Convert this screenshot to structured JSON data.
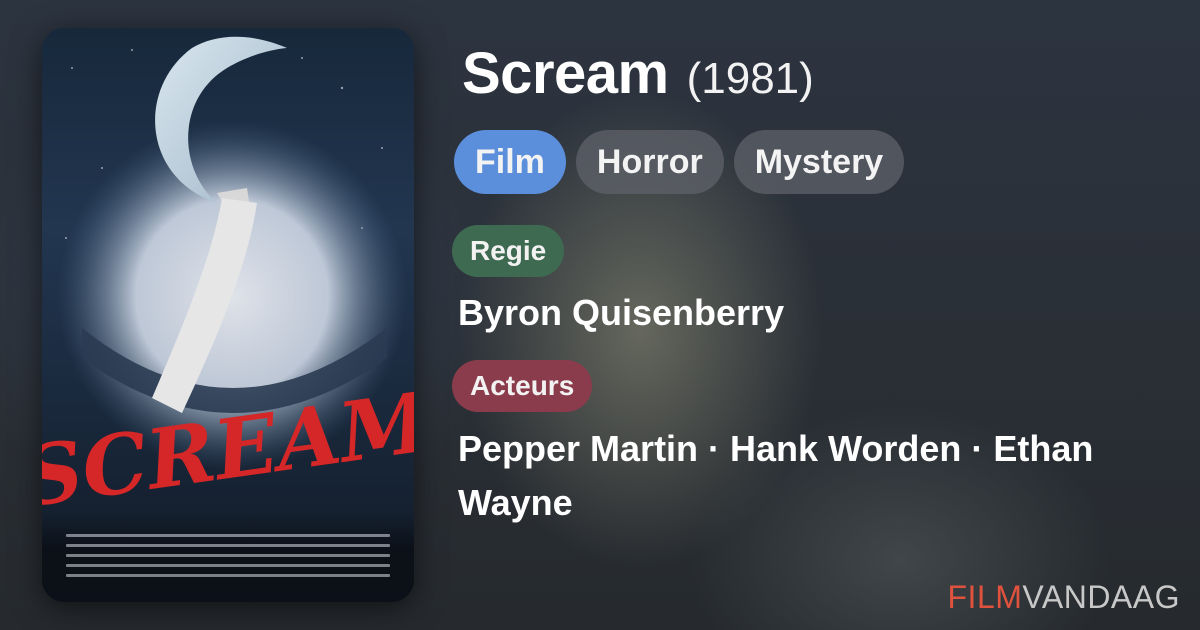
{
  "movie": {
    "title": "Scream",
    "year": "(1981)"
  },
  "genres": [
    "Film",
    "Horror",
    "Mystery"
  ],
  "director": {
    "label": "Regie",
    "name": "Byron Quisenberry"
  },
  "cast": {
    "label": "Acteurs",
    "names": "Pepper Martin · Hank Worden · Ethan Wayne"
  },
  "poster": {
    "title_text": "SCREAM"
  },
  "logo": {
    "part1": "FILM",
    "part2": "VANDAAG"
  },
  "colors": {
    "film_chip": "#5b8fdc",
    "genre_chip": "#5f6269",
    "regie_label": "#3f6a52",
    "acteurs_label": "#8b3c4c",
    "logo_accent": "#e0523d"
  }
}
